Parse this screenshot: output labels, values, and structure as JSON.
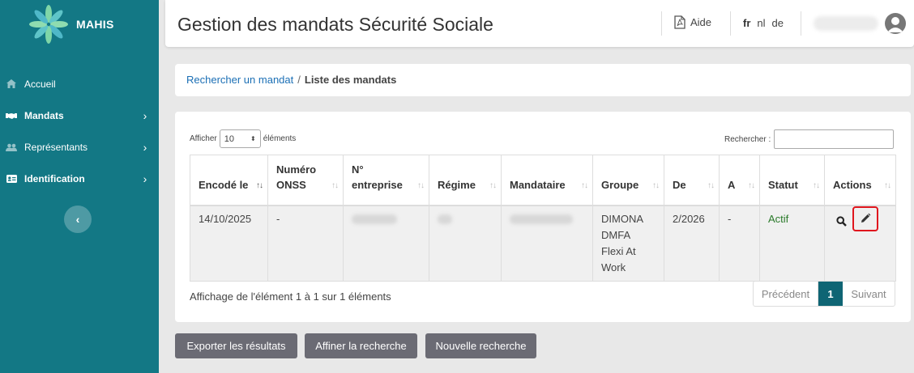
{
  "app": {
    "name": "MAHIS",
    "brand_color": "#137885",
    "accent": "#0f6574"
  },
  "sidebar": {
    "items": [
      {
        "label": "Accueil",
        "icon": "home-icon"
      },
      {
        "label": "Mandats",
        "icon": "handshake-icon"
      },
      {
        "label": "Représentants",
        "icon": "users-icon"
      },
      {
        "label": "Identification",
        "icon": "id-card-icon"
      }
    ],
    "collapse_icon": "chevron-left-icon"
  },
  "header": {
    "title": "Gestion des mandats Sécurité Sociale",
    "help_label": "Aide",
    "languages": [
      "fr",
      "nl",
      "de"
    ],
    "active_language": "fr"
  },
  "breadcrumb": {
    "link": "Rechercher un mandat",
    "separator": "/",
    "current": "Liste des mandats"
  },
  "table_controls": {
    "show_prefix": "Afficher",
    "page_size": "10",
    "show_suffix": "éléments",
    "search_label": "Rechercher :"
  },
  "table": {
    "columns": [
      "Encodé le",
      "Numéro ONSS",
      "N° entreprise",
      "Régime",
      "Mandataire",
      "Groupe",
      "De",
      "A",
      "Statut",
      "Actions"
    ],
    "rows": [
      {
        "encode_le": "14/10/2025",
        "numero_onss": "-",
        "groupe": [
          "DIMONA",
          "DMFA",
          "Flexi At Work"
        ],
        "de": "2/2026",
        "a": "-",
        "statut": "Actif"
      }
    ]
  },
  "pagination": {
    "info": "Affichage de l'élément 1 à 1 sur 1 éléments",
    "prev": "Précédent",
    "current": "1",
    "next": "Suivant"
  },
  "buttons": {
    "export": "Exporter les résultats",
    "refine": "Affiner la recherche",
    "new_search": "Nouvelle recherche"
  }
}
